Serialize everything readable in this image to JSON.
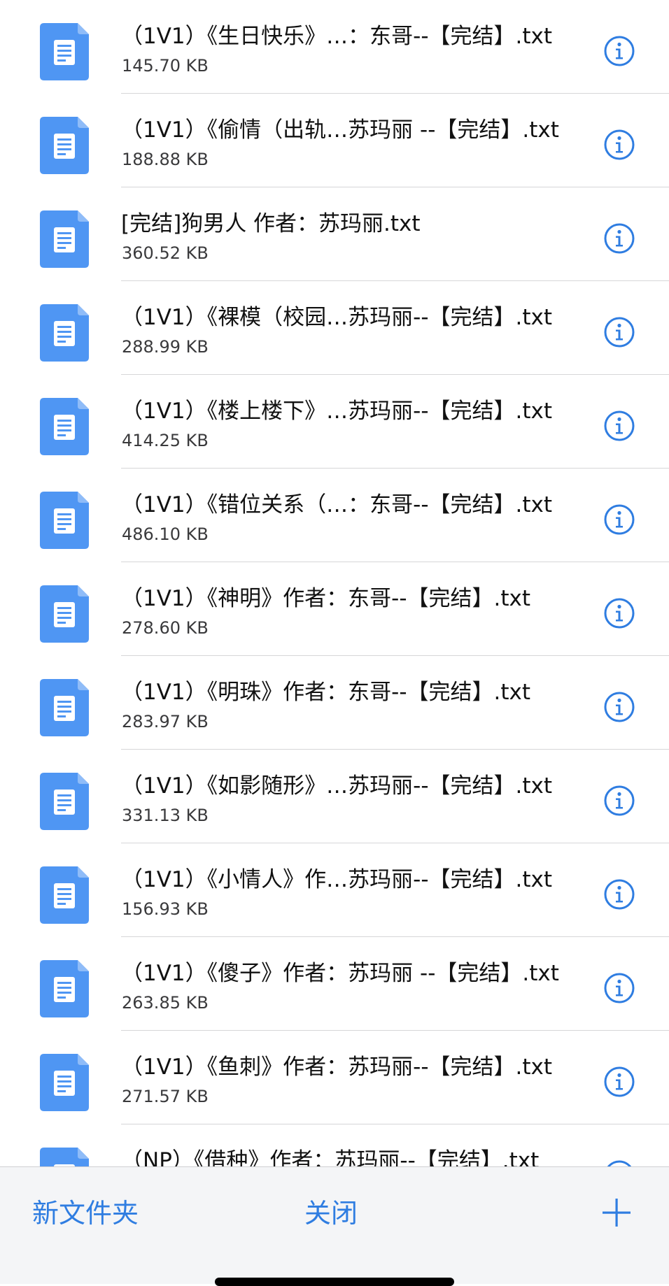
{
  "files": [
    {
      "name": "（1V1）《生日快乐》…：东哥--【完结】.txt",
      "size": "145.70 KB"
    },
    {
      "name": "（1V1）《偷情（出轨…苏玛丽 --【完结】.txt",
      "size": "188.88 KB"
    },
    {
      "name": "[完结]狗男人 作者：苏玛丽.txt",
      "size": "360.52 KB"
    },
    {
      "name": "（1V1）《裸模（校园…苏玛丽--【完结】.txt",
      "size": "288.99 KB"
    },
    {
      "name": "（1V1）《楼上楼下》…苏玛丽--【完结】.txt",
      "size": "414.25 KB"
    },
    {
      "name": "（1V1）《错位关系（…：东哥--【完结】.txt",
      "size": "486.10 KB"
    },
    {
      "name": "（1V1）《神明》作者：东哥--【完结】.txt",
      "size": "278.60 KB"
    },
    {
      "name": "（1V1）《明珠》作者：东哥--【完结】.txt",
      "size": "283.97 KB"
    },
    {
      "name": "（1V1）《如影随形》…苏玛丽--【完结】.txt",
      "size": "331.13 KB"
    },
    {
      "name": "（1V1）《小情人》作…苏玛丽--【完结】.txt",
      "size": "156.93 KB"
    },
    {
      "name": "（1V1）《傻子》作者：苏玛丽 --【完结】.txt",
      "size": "263.85 KB"
    },
    {
      "name": "（1V1）《鱼刺》作者：苏玛丽--【完结】.txt",
      "size": "271.57 KB"
    },
    {
      "name": "（NP）《借种》作者：苏玛丽--【完结】.txt",
      "size": ""
    }
  ],
  "toolbar": {
    "new_folder_label": "新文件夹",
    "close_label": "关闭",
    "add_icon": "plus-icon"
  },
  "icons": {
    "file": "document-icon",
    "info": "info-icon"
  },
  "colors": {
    "accent": "#2f7de1",
    "file_icon": "#4f96f3"
  }
}
